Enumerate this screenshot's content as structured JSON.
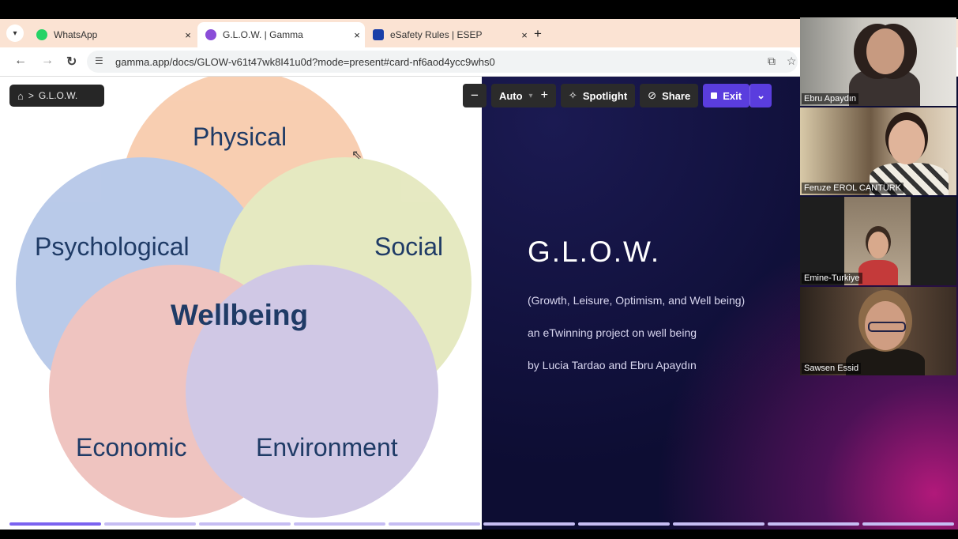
{
  "browser": {
    "tabs": [
      {
        "title": "WhatsApp",
        "favicon_color": "#25D366",
        "active": false
      },
      {
        "title": "G.L.O.W. | Gamma",
        "favicon_color": "#8a4dd8",
        "active": true
      },
      {
        "title": "eSafety Rules | ESEP",
        "favicon_color": "#1a3fa8",
        "active": false
      }
    ],
    "close_glyph": "×",
    "new_tab_glyph": "+",
    "url": "gamma.app/docs/GLOW-v61t47wk8I41u0d?mode=present#card-nf6aod4ycc9whs0"
  },
  "presentation": {
    "breadcrumb": {
      "home_icon": "home-icon",
      "separator": ">",
      "label": "G.L.O.W."
    },
    "toolbar": {
      "zoom_out": "−",
      "zoom_label": "Auto",
      "zoom_in": "+",
      "spotlight": "Spotlight",
      "share": "Share",
      "exit": "Exit"
    },
    "venn": {
      "labels": {
        "top": "Physical",
        "left": "Psychological",
        "right": "Social",
        "center": "Wellbeing",
        "bottom_left": "Economic",
        "bottom_right": "Environment"
      },
      "colors": {
        "physical": "#f4b183",
        "psychological": "#8faadc",
        "social": "#d6dc9c",
        "economic": "#e6a19b",
        "environment": "#b4a7d6"
      }
    },
    "slide": {
      "title": "G.L.O.W.",
      "line1": "(Growth, Leisure, Optimism, and Well being)",
      "line2": "an eTwinning project on well being",
      "line3": "by Lucia Tardao and Ebru Apaydın"
    },
    "colors": {
      "accent": "#5a3dde",
      "progress_active": "#7b63f0",
      "progress_inactive": "#c6bdf3"
    }
  },
  "participants": [
    {
      "name": "Ebru Apaydın"
    },
    {
      "name": "Feruze EROL CANTÜRK"
    },
    {
      "name": "Emine-Turkiye"
    },
    {
      "name": "Sawsen Essid"
    }
  ]
}
